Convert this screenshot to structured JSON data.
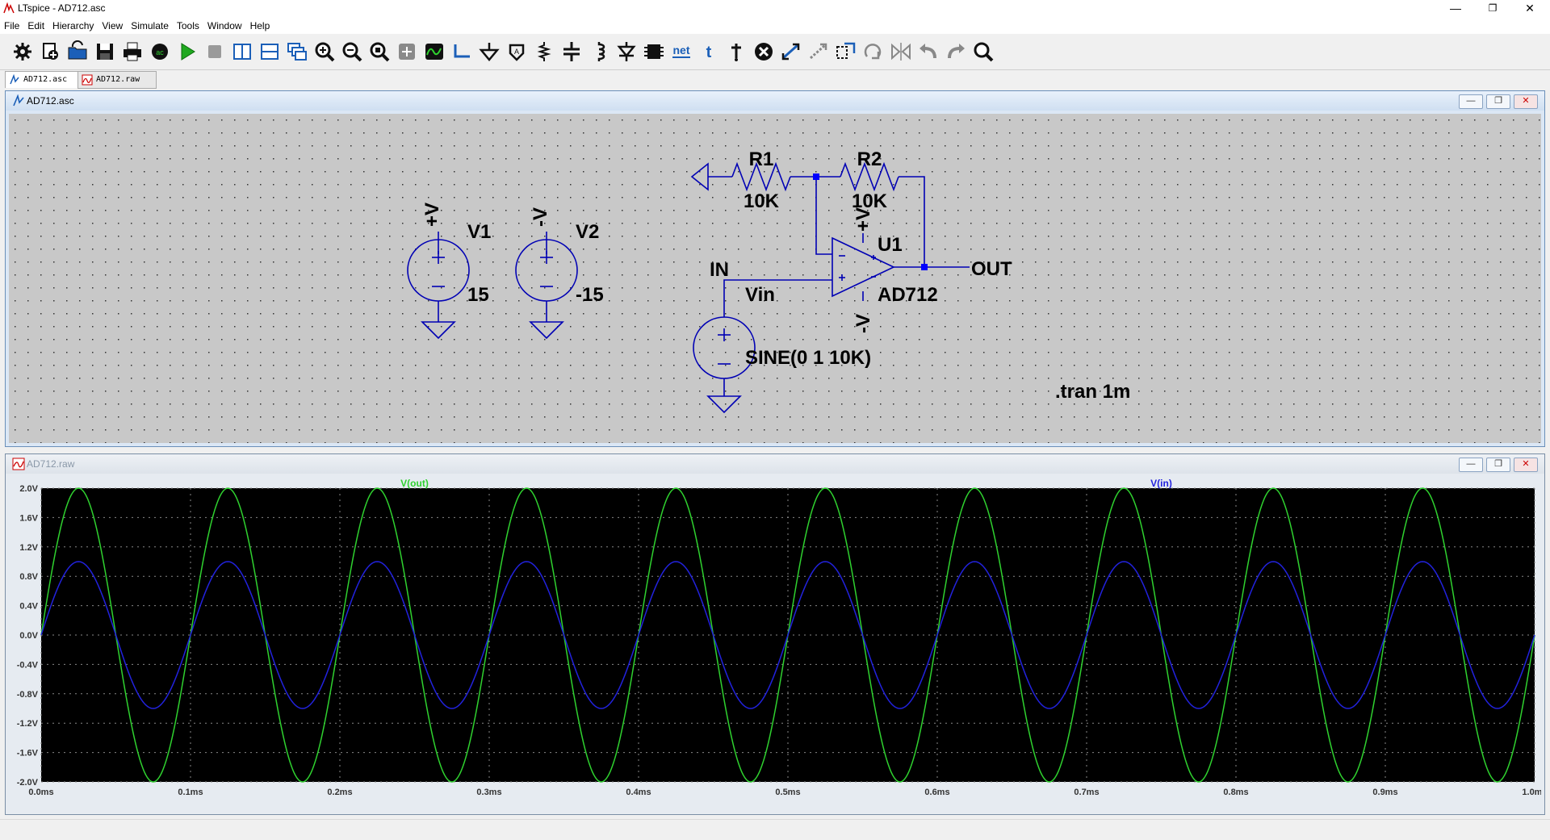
{
  "window": {
    "title": "LTspice - AD712.asc",
    "min_glyph": "—",
    "max_glyph": "❐",
    "close_glyph": "✕"
  },
  "menu": [
    "File",
    "Edit",
    "Hierarchy",
    "View",
    "Simulate",
    "Tools",
    "Window",
    "Help"
  ],
  "toolbar": {
    "icons": [
      "settings-icon",
      "new-schematic-icon",
      "open-icon",
      "save-icon",
      "print-icon",
      "run-ac-icon",
      "run-icon",
      "halt-icon",
      "tile-vertical-icon",
      "tile-horizontal-icon",
      "cascade-icon",
      "zoom-in-icon",
      "zoom-out-icon",
      "zoom-fit-icon",
      "zoom-full-icon",
      "waveform-icon",
      "wire-icon",
      "ground-icon",
      "label-net-icon",
      "resistor-icon",
      "capacitor-icon",
      "inductor-icon",
      "diode-icon",
      "component-icon",
      "net-icon",
      "text-icon",
      "spice-directive-icon",
      "delete-icon",
      "move-icon",
      "drag-icon",
      "duplicate-icon",
      "rotate-icon",
      "mirror-icon",
      "undo-icon",
      "redo-icon",
      "find-icon"
    ],
    "net_label": "net",
    "text_label": "t"
  },
  "tabs": [
    {
      "label": "AD712.asc",
      "active": true
    },
    {
      "label": "AD712.raw",
      "active": false
    }
  ],
  "schematic": {
    "title": "AD712.asc",
    "components": {
      "r1": {
        "name": "R1",
        "value": "10K"
      },
      "r2": {
        "name": "R2",
        "value": "10K"
      },
      "u1": {
        "name": "U1",
        "value": "AD712"
      },
      "v1": {
        "name": "V1",
        "value": "15",
        "net": "+V"
      },
      "v2": {
        "name": "V2",
        "value": "-15",
        "net": "-V"
      },
      "vin": {
        "name": "Vin",
        "value": "SINE(0 1 10K)"
      }
    },
    "labels": {
      "in": "IN",
      "out": "OUT",
      "opamp_plus_v": "+V",
      "opamp_minus_v": "-V"
    },
    "directive": ".tran 1m",
    "colors": {
      "background": "#c8c8c8",
      "wire": "#0000b4",
      "junction": "#0000ff",
      "text": "#000000"
    }
  },
  "waveform": {
    "title": "AD712.raw",
    "traces": [
      {
        "name": "V(out)",
        "color": "#2fd12f"
      },
      {
        "name": "V(in)",
        "color": "#2222dd"
      }
    ]
  },
  "chart_data": {
    "type": "line",
    "xlabel": "",
    "ylabel": "",
    "xlim": [
      0,
      1.0
    ],
    "ylim": [
      -2.0,
      2.0
    ],
    "x_unit": "ms",
    "x_ticks": [
      "0.0ms",
      "0.1ms",
      "0.2ms",
      "0.3ms",
      "0.4ms",
      "0.5ms",
      "0.6ms",
      "0.7ms",
      "0.8ms",
      "0.9ms",
      "1.0ms"
    ],
    "y_ticks": [
      "2.0V",
      "1.6V",
      "1.2V",
      "0.8V",
      "0.4V",
      "0.0V",
      "-0.4V",
      "-0.8V",
      "-1.2V",
      "-1.6V",
      "-2.0V"
    ],
    "grid": true,
    "legend": "top",
    "series": [
      {
        "name": "V(out)",
        "function": "sine",
        "amplitude": 2.0,
        "frequency_hz": 10000,
        "offset": 0
      },
      {
        "name": "V(in)",
        "function": "sine",
        "amplitude": 1.0,
        "frequency_hz": 10000,
        "offset": 0
      }
    ]
  }
}
